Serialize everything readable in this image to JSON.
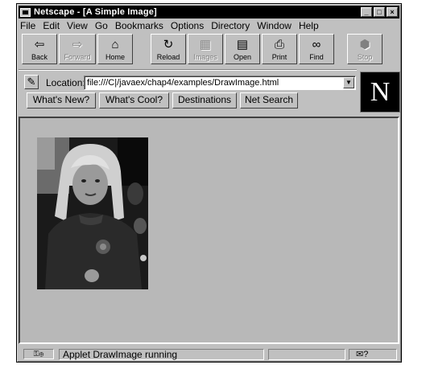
{
  "window": {
    "title": "Netscape - [A Simple Image]"
  },
  "menu": [
    "File",
    "Edit",
    "View",
    "Go",
    "Bookmarks",
    "Options",
    "Directory",
    "Window",
    "Help"
  ],
  "toolbar": {
    "back": "Back",
    "forward": "Forward",
    "home": "Home",
    "reload": "Reload",
    "images": "Images",
    "open": "Open",
    "print": "Print",
    "find": "Find",
    "stop": "Stop"
  },
  "location": {
    "label": "Location:",
    "url": "file:///C|/javaex/chap4/examples/DrawImage.html"
  },
  "directory_buttons": {
    "whats_new": "What's New?",
    "whats_cool": "What's Cool?",
    "destinations": "Destinations",
    "net_search": "Net Search"
  },
  "logo": {
    "letter": "N"
  },
  "status": {
    "text": "Applet DrawImage running",
    "mail_indicator": "✉?"
  },
  "icons": {
    "back": "back-arrow-icon",
    "forward": "forward-arrow-icon",
    "home": "house-icon",
    "reload": "reload-icon",
    "images": "images-icon",
    "open": "open-icon",
    "print": "printer-icon",
    "find": "binoculars-icon",
    "stop": "stop-sign-icon",
    "location": "bookmark-page-icon",
    "security": "security-key-icon",
    "mail": "mail-icon"
  }
}
